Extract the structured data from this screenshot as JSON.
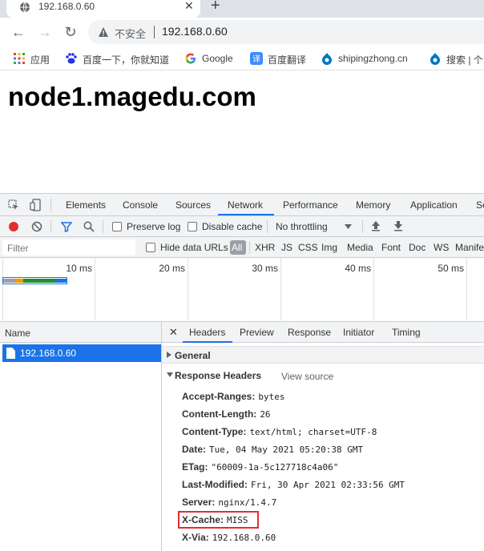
{
  "browser": {
    "tab_title": "192.168.0.60",
    "close_glyph": "✕",
    "new_tab_glyph": "+",
    "back_glyph": "←",
    "forward_glyph": "→",
    "reload_glyph": "↻",
    "security_label": "不安全",
    "url": "192.168.0.60"
  },
  "bookmarks": [
    {
      "label": "应用",
      "icon": "apps-grid-icon"
    },
    {
      "label": "百度一下，你就知道",
      "icon": "baidu-paw-icon"
    },
    {
      "label": "Google",
      "icon": "google-g-icon"
    },
    {
      "label": "百度翻译",
      "icon": "baidu-translate-icon"
    },
    {
      "label": "shipingzhong.cn",
      "icon": "drupal-drop-icon"
    },
    {
      "label": "搜索 | 个",
      "icon": "drupal-drop-icon"
    }
  ],
  "page": {
    "heading": "node1.magedu.com"
  },
  "devtools": {
    "tabs": [
      "Elements",
      "Console",
      "Sources",
      "Network",
      "Performance",
      "Memory",
      "Application",
      "Se"
    ],
    "active_tab": "Network",
    "toolbar": {
      "preserve_log": "Preserve log",
      "disable_cache": "Disable cache",
      "throttling": "No throttling"
    },
    "filter": {
      "placeholder": "Filter",
      "hide_data_urls": "Hide data URLs",
      "all": "All",
      "types": [
        "XHR",
        "JS",
        "CSS",
        "Img",
        "Media",
        "Font",
        "Doc",
        "WS",
        "Manife"
      ]
    },
    "overview": {
      "ticks": [
        "10 ms",
        "20 ms",
        "30 ms",
        "40 ms",
        "50 ms"
      ]
    },
    "requests": {
      "column": "Name",
      "items": [
        "192.168.0.60"
      ]
    },
    "details": {
      "tabs": [
        "Headers",
        "Preview",
        "Response",
        "Initiator",
        "Timing"
      ],
      "active_tab": "Headers",
      "general_label": "General",
      "response_headers_label": "Response Headers",
      "view_source": "View source",
      "headers": [
        {
          "key": "Accept-Ranges:",
          "value": "bytes"
        },
        {
          "key": "Content-Length:",
          "value": "26"
        },
        {
          "key": "Content-Type:",
          "value": "text/html; charset=UTF-8"
        },
        {
          "key": "Date:",
          "value": "Tue, 04 May 2021 05:20:38 GMT"
        },
        {
          "key": "ETag:",
          "value": "\"60009-1a-5c127718c4a06\""
        },
        {
          "key": "Last-Modified:",
          "value": "Fri, 30 Apr 2021 02:33:56 GMT"
        },
        {
          "key": "Server:",
          "value": "nginx/1.4.7"
        },
        {
          "key": "X-Cache:",
          "value": "MISS"
        },
        {
          "key": "X-Via:",
          "value": "192.168.0.60"
        }
      ]
    }
  },
  "colors": {
    "accent": "#1a73e8",
    "highlight_box": "#e0302f",
    "record": "#e0302f"
  }
}
